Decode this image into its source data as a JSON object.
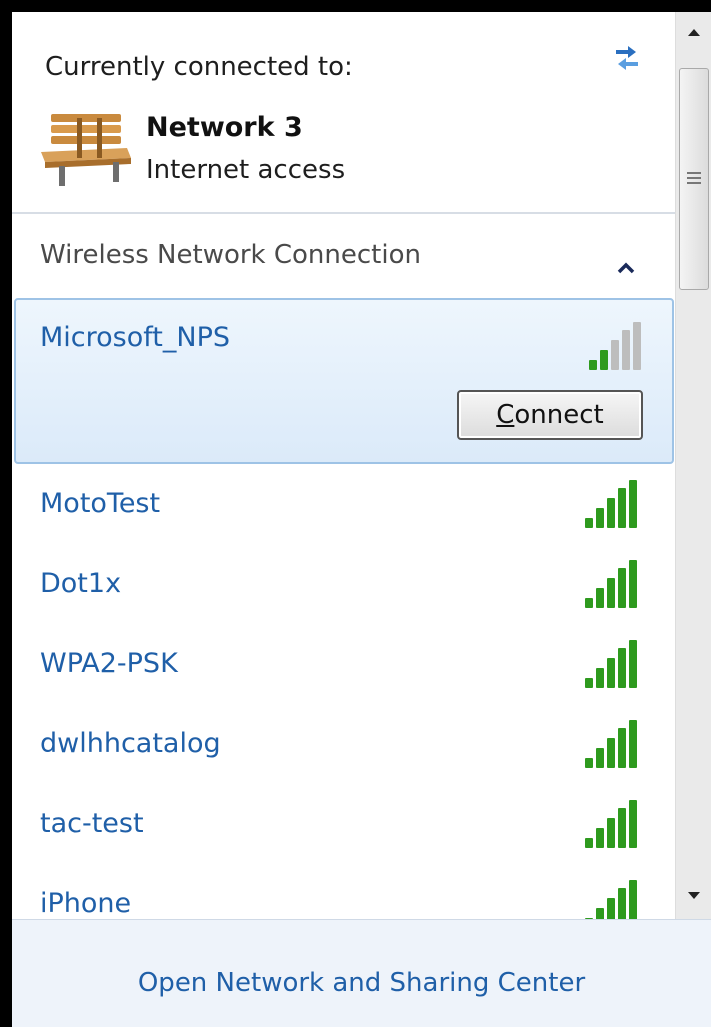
{
  "header": {
    "title": "Currently connected to:",
    "refresh_icon": "refresh-icon"
  },
  "current_network": {
    "icon": "bench-icon",
    "name": "Network  3",
    "status": "Internet access"
  },
  "section": {
    "title": "Wireless Network Connection",
    "expanded": true
  },
  "selected_network": {
    "name": "Microsoft_NPS",
    "signal_bars": 2,
    "connect_button": {
      "mnemonic": "C",
      "rest": "onnect"
    }
  },
  "networks": [
    {
      "name": "MotoTest",
      "signal_bars": 5
    },
    {
      "name": "Dot1x",
      "signal_bars": 5
    },
    {
      "name": "WPA2-PSK",
      "signal_bars": 5
    },
    {
      "name": "dwlhhcatalog",
      "signal_bars": 5
    },
    {
      "name": "tac-test",
      "signal_bars": 5
    },
    {
      "name": "iPhone",
      "signal_bars": 5
    }
  ],
  "footer": {
    "link": "Open Network and Sharing Center"
  },
  "colors": {
    "link": "#1f5fa8",
    "signal_active": "#2e9a1e",
    "signal_inactive": "#bdbdbd"
  }
}
